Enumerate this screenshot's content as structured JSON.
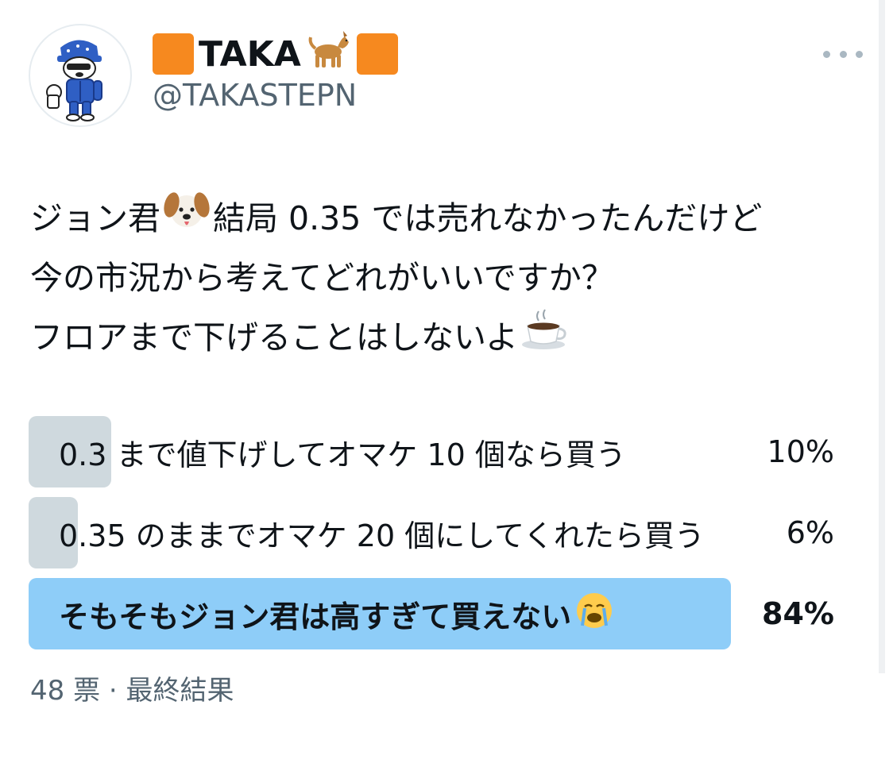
{
  "user": {
    "display_name_text": "TAKA",
    "handle": "@TAKASTEPN"
  },
  "icons": {
    "name_left": "orange-square-icon",
    "name_dog": "dog-icon",
    "name_right": "orange-square-icon",
    "more": "more-options-icon",
    "puppy": "dog-face-icon",
    "coffee": "hot-beverage-icon",
    "crying": "loudly-crying-face-icon"
  },
  "tweet": {
    "line1_a": "ジョン君",
    "line1_b": "結局 0.35 では売れなかったんだけど",
    "line2": "今の市況から考えてどれがいいですか？",
    "line3": "フロアまで下げることはしないよ"
  },
  "poll": {
    "options": [
      {
        "label": "0.3 まで値下げしてオマケ 10 個なら買う",
        "percent": "10%",
        "share": 10
      },
      {
        "label": "0.35 のままでオマケ 20 個にしてくれたら買う",
        "percent": "6%",
        "share": 6
      },
      {
        "label": "そもそもジョン君は高すぎて買えない",
        "percent": "84%",
        "share": 84
      }
    ],
    "footer": "48 票 · 最終結果"
  },
  "colors": {
    "winner_bar": "#8ecdf8",
    "loser_bar": "#cfd9de",
    "orange_square": "#f6891f",
    "secondary_text": "#536471"
  }
}
